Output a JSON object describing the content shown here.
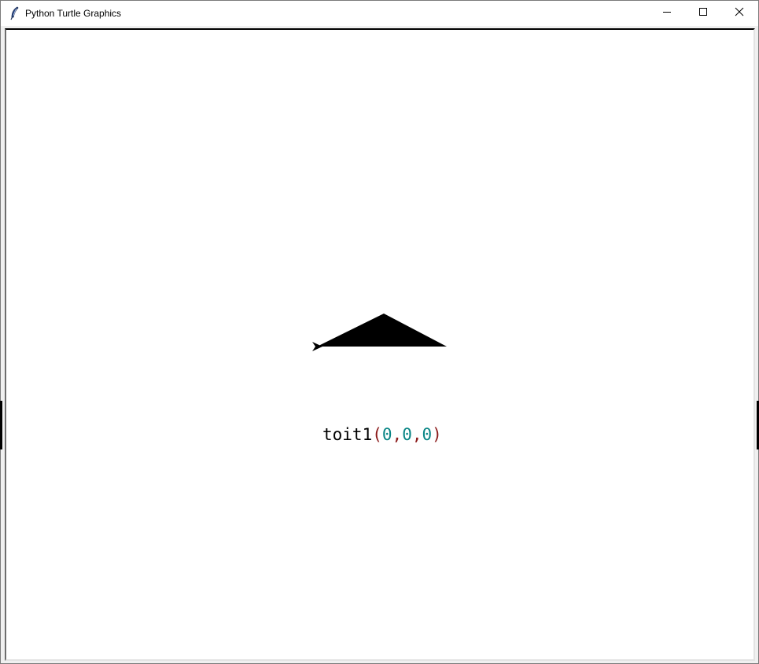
{
  "window": {
    "title": "Python Turtle Graphics",
    "controls": {
      "minimize_icon": "minimize-icon",
      "maximize_icon": "maximize-icon",
      "close_icon": "close-icon"
    }
  },
  "canvas": {
    "background": "#ffffff",
    "shape": {
      "name": "roof-triangle",
      "fill": "#000000"
    },
    "turtle": {
      "heading": "east",
      "color": "#000000"
    }
  },
  "overlay": {
    "func_name": "toit1",
    "open_paren": "(",
    "arg1": "0",
    "comma1": ",",
    "arg2": "0",
    "comma2": ",",
    "arg3": "0",
    "close_paren": ")",
    "colors": {
      "func": "#000000",
      "paren": "#8b1a1a",
      "number": "#098585",
      "comma": "#8b1a1a"
    }
  }
}
